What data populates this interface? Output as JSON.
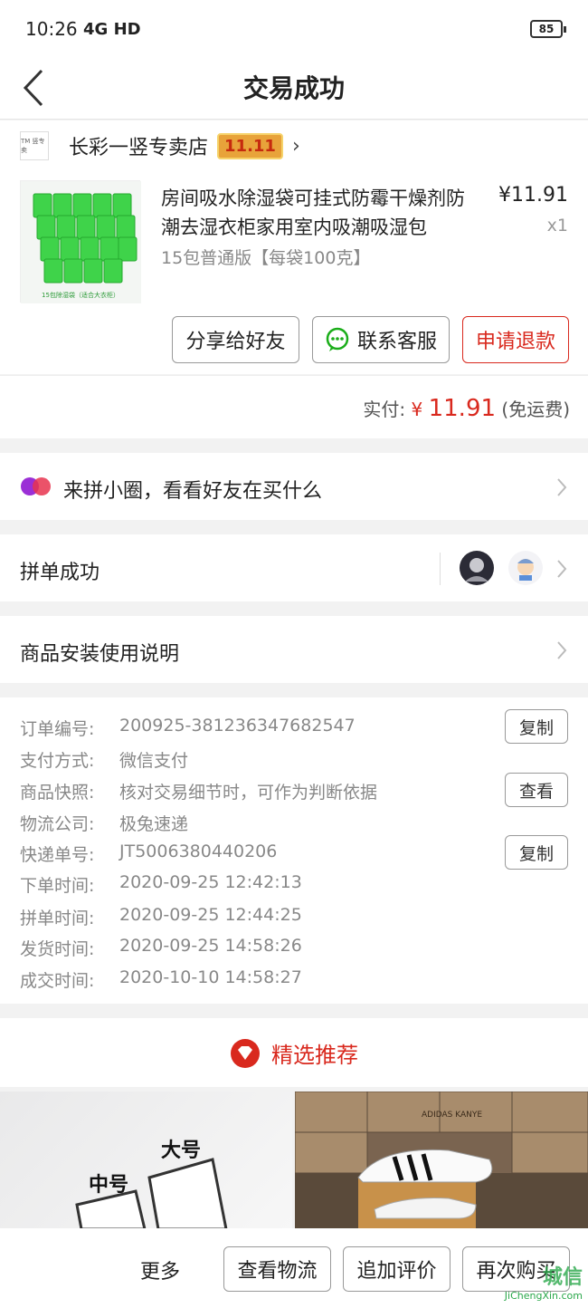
{
  "status_bar": {
    "time": "10:26",
    "network": "4G HD",
    "battery": "85"
  },
  "header": {
    "title": "交易成功"
  },
  "shop": {
    "logo_text": "TM 竖专卖",
    "name": "长彩一竖专卖店",
    "badge": "11.11"
  },
  "product": {
    "title": "房间吸水除湿袋可挂式防霉干燥剂防潮去湿衣柜家用室内吸潮吸湿包",
    "spec": "15包普通版【每袋100克】",
    "price": "¥11.91",
    "quantity": "x1",
    "image_caption": "15包除湿袋（适合大衣柜）"
  },
  "actions": {
    "share": "分享给好友",
    "service": "联系客服",
    "refund": "申请退款"
  },
  "payment": {
    "label": "实付:",
    "currency": "¥",
    "amount": "11.91",
    "shipping": "(免运费)"
  },
  "circle": {
    "text": "来拼小圈，看看好友在买什么"
  },
  "group": {
    "text": "拼单成功"
  },
  "manual": {
    "text": "商品安装使用说明"
  },
  "order_info": [
    {
      "label": "订单编号:",
      "value": "200925-381236347682547",
      "button": "复制"
    },
    {
      "label": "支付方式:",
      "value": "微信支付",
      "button": ""
    },
    {
      "label": "商品快照:",
      "value": "核对交易细节时，可作为判断依据",
      "button": "查看"
    },
    {
      "label": "物流公司:",
      "value": "极兔速递",
      "button": ""
    },
    {
      "label": "快递单号:",
      "value": "JT5006380440206",
      "button": "复制"
    },
    {
      "label": "下单时间:",
      "value": "2020-09-25 12:42:13",
      "button": ""
    },
    {
      "label": "拼单时间:",
      "value": "2020-09-25 12:44:25",
      "button": ""
    },
    {
      "label": "发货时间:",
      "value": "2020-09-25 14:58:26",
      "button": ""
    },
    {
      "label": "成交时间:",
      "value": "2020-10-10 14:58:27",
      "button": ""
    }
  ],
  "recommend": {
    "title": "精选推荐",
    "left_labels": [
      "大号",
      "中号"
    ],
    "right_box_text": "ADIDAS KANYE"
  },
  "footer": {
    "more": "更多",
    "logistics": "查看物流",
    "review": "追加评价",
    "rebuy": "再次购买"
  },
  "watermark": {
    "brand": "城信",
    "url": "JiChengXin.com"
  },
  "colors": {
    "accent": "#d9291e",
    "wechat_green": "#1aad19"
  }
}
